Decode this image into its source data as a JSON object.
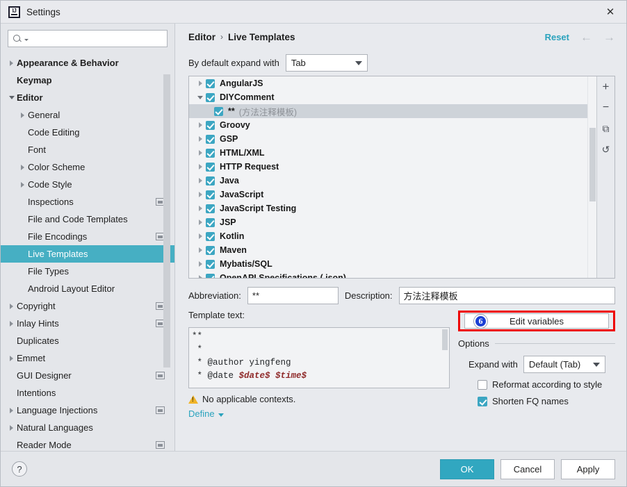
{
  "window": {
    "title": "Settings",
    "logo_text": "IJ",
    "close_icon": "✕"
  },
  "sidebar": {
    "search": {
      "value": "",
      "placeholder": ""
    },
    "items": [
      {
        "label": "Appearance & Behavior",
        "arrow": "closed",
        "indent": 0,
        "bold": true,
        "badge": false,
        "selected": false
      },
      {
        "label": "Keymap",
        "arrow": "none",
        "indent": 0,
        "bold": true,
        "badge": false,
        "selected": false
      },
      {
        "label": "Editor",
        "arrow": "open",
        "indent": 0,
        "bold": true,
        "badge": false,
        "selected": false
      },
      {
        "label": "General",
        "arrow": "closed",
        "indent": 1,
        "bold": false,
        "badge": false,
        "selected": false
      },
      {
        "label": "Code Editing",
        "arrow": "none",
        "indent": 1,
        "bold": false,
        "badge": false,
        "selected": false
      },
      {
        "label": "Font",
        "arrow": "none",
        "indent": 1,
        "bold": false,
        "badge": false,
        "selected": false
      },
      {
        "label": "Color Scheme",
        "arrow": "closed",
        "indent": 1,
        "bold": false,
        "badge": false,
        "selected": false
      },
      {
        "label": "Code Style",
        "arrow": "closed",
        "indent": 1,
        "bold": false,
        "badge": false,
        "selected": false
      },
      {
        "label": "Inspections",
        "arrow": "none",
        "indent": 1,
        "bold": false,
        "badge": true,
        "selected": false
      },
      {
        "label": "File and Code Templates",
        "arrow": "none",
        "indent": 1,
        "bold": false,
        "badge": false,
        "selected": false
      },
      {
        "label": "File Encodings",
        "arrow": "none",
        "indent": 1,
        "bold": false,
        "badge": true,
        "selected": false
      },
      {
        "label": "Live Templates",
        "arrow": "none",
        "indent": 1,
        "bold": false,
        "badge": false,
        "selected": true
      },
      {
        "label": "File Types",
        "arrow": "none",
        "indent": 1,
        "bold": false,
        "badge": false,
        "selected": false
      },
      {
        "label": "Android Layout Editor",
        "arrow": "none",
        "indent": 1,
        "bold": false,
        "badge": false,
        "selected": false
      },
      {
        "label": "Copyright",
        "arrow": "closed",
        "indent": 0,
        "bold": false,
        "badge": true,
        "selected": false
      },
      {
        "label": "Inlay Hints",
        "arrow": "closed",
        "indent": 0,
        "bold": false,
        "badge": true,
        "selected": false
      },
      {
        "label": "Duplicates",
        "arrow": "none",
        "indent": 0,
        "bold": false,
        "badge": false,
        "selected": false
      },
      {
        "label": "Emmet",
        "arrow": "closed",
        "indent": 0,
        "bold": false,
        "badge": false,
        "selected": false
      },
      {
        "label": "GUI Designer",
        "arrow": "none",
        "indent": 0,
        "bold": false,
        "badge": true,
        "selected": false
      },
      {
        "label": "Intentions",
        "arrow": "none",
        "indent": 0,
        "bold": false,
        "badge": false,
        "selected": false
      },
      {
        "label": "Language Injections",
        "arrow": "closed",
        "indent": 0,
        "bold": false,
        "badge": true,
        "selected": false
      },
      {
        "label": "Natural Languages",
        "arrow": "closed",
        "indent": 0,
        "bold": false,
        "badge": false,
        "selected": false
      },
      {
        "label": "Reader Mode",
        "arrow": "none",
        "indent": 0,
        "bold": false,
        "badge": true,
        "selected": false
      }
    ]
  },
  "header": {
    "breadcrumb": [
      "Editor",
      "Live Templates"
    ],
    "separator": "›",
    "reset_label": "Reset",
    "back_icon": "←",
    "forward_icon": "→"
  },
  "expand": {
    "label": "By default expand with",
    "value": "Tab"
  },
  "templates": {
    "rows": [
      {
        "label": "AngularJS",
        "desc": "",
        "arrow": "closed",
        "checked": true,
        "child": false,
        "selected": false
      },
      {
        "label": "DIYComment",
        "desc": "",
        "arrow": "open",
        "checked": true,
        "child": false,
        "selected": false
      },
      {
        "label": "**",
        "desc": "(方法注释模板)",
        "arrow": "none",
        "checked": true,
        "child": true,
        "selected": true
      },
      {
        "label": "Groovy",
        "desc": "",
        "arrow": "closed",
        "checked": true,
        "child": false,
        "selected": false
      },
      {
        "label": "GSP",
        "desc": "",
        "arrow": "closed",
        "checked": true,
        "child": false,
        "selected": false
      },
      {
        "label": "HTML/XML",
        "desc": "",
        "arrow": "closed",
        "checked": true,
        "child": false,
        "selected": false
      },
      {
        "label": "HTTP Request",
        "desc": "",
        "arrow": "closed",
        "checked": true,
        "child": false,
        "selected": false
      },
      {
        "label": "Java",
        "desc": "",
        "arrow": "closed",
        "checked": true,
        "child": false,
        "selected": false
      },
      {
        "label": "JavaScript",
        "desc": "",
        "arrow": "closed",
        "checked": true,
        "child": false,
        "selected": false
      },
      {
        "label": "JavaScript Testing",
        "desc": "",
        "arrow": "closed",
        "checked": true,
        "child": false,
        "selected": false
      },
      {
        "label": "JSP",
        "desc": "",
        "arrow": "closed",
        "checked": true,
        "child": false,
        "selected": false
      },
      {
        "label": "Kotlin",
        "desc": "",
        "arrow": "closed",
        "checked": true,
        "child": false,
        "selected": false
      },
      {
        "label": "Maven",
        "desc": "",
        "arrow": "closed",
        "checked": true,
        "child": false,
        "selected": false
      },
      {
        "label": "Mybatis/SQL",
        "desc": "",
        "arrow": "closed",
        "checked": true,
        "child": false,
        "selected": false
      },
      {
        "label": "OpenAPI Specifications (.json)",
        "desc": "",
        "arrow": "closed",
        "checked": true,
        "child": false,
        "selected": false
      }
    ],
    "tools": [
      {
        "name": "add-template-button",
        "glyph": "+"
      },
      {
        "name": "remove-template-button",
        "glyph": "−"
      },
      {
        "name": "copy-template-button",
        "glyph": "⧉"
      },
      {
        "name": "restore-template-button",
        "glyph": "↺"
      }
    ]
  },
  "form": {
    "abbreviation_label": "Abbreviation:",
    "abbreviation_value": "**",
    "description_label": "Description:",
    "description_value": "方法注释模板",
    "template_text_label": "Template text:",
    "template_lines": [
      {
        "text": "**"
      },
      {
        "text": " *"
      },
      {
        "text": " * @author yingfeng"
      },
      {
        "text": " * @date ",
        "variables": "$date$ $time$"
      }
    ],
    "context_warning": "No applicable contexts.",
    "define_label": "Define"
  },
  "edit_variables": {
    "label": "Edit variables",
    "badge": "6",
    "badge_color": "#1c3fd4",
    "highlight_color": "#ee0000"
  },
  "options": {
    "title": "Options",
    "expand_with_label": "Expand with",
    "expand_with_value": "Default (Tab)",
    "reformat_label": "Reformat according to style",
    "reformat_checked": false,
    "shorten_label": "Shorten FQ names",
    "shorten_checked": true
  },
  "footer": {
    "help_glyph": "?",
    "ok_label": "OK",
    "cancel_label": "Cancel",
    "apply_label": "Apply"
  },
  "colors": {
    "accent": "#46afc3",
    "checkbox": "#3ca6c2",
    "link": "#2aa3bd",
    "variable_text": "#8f2a2a"
  }
}
